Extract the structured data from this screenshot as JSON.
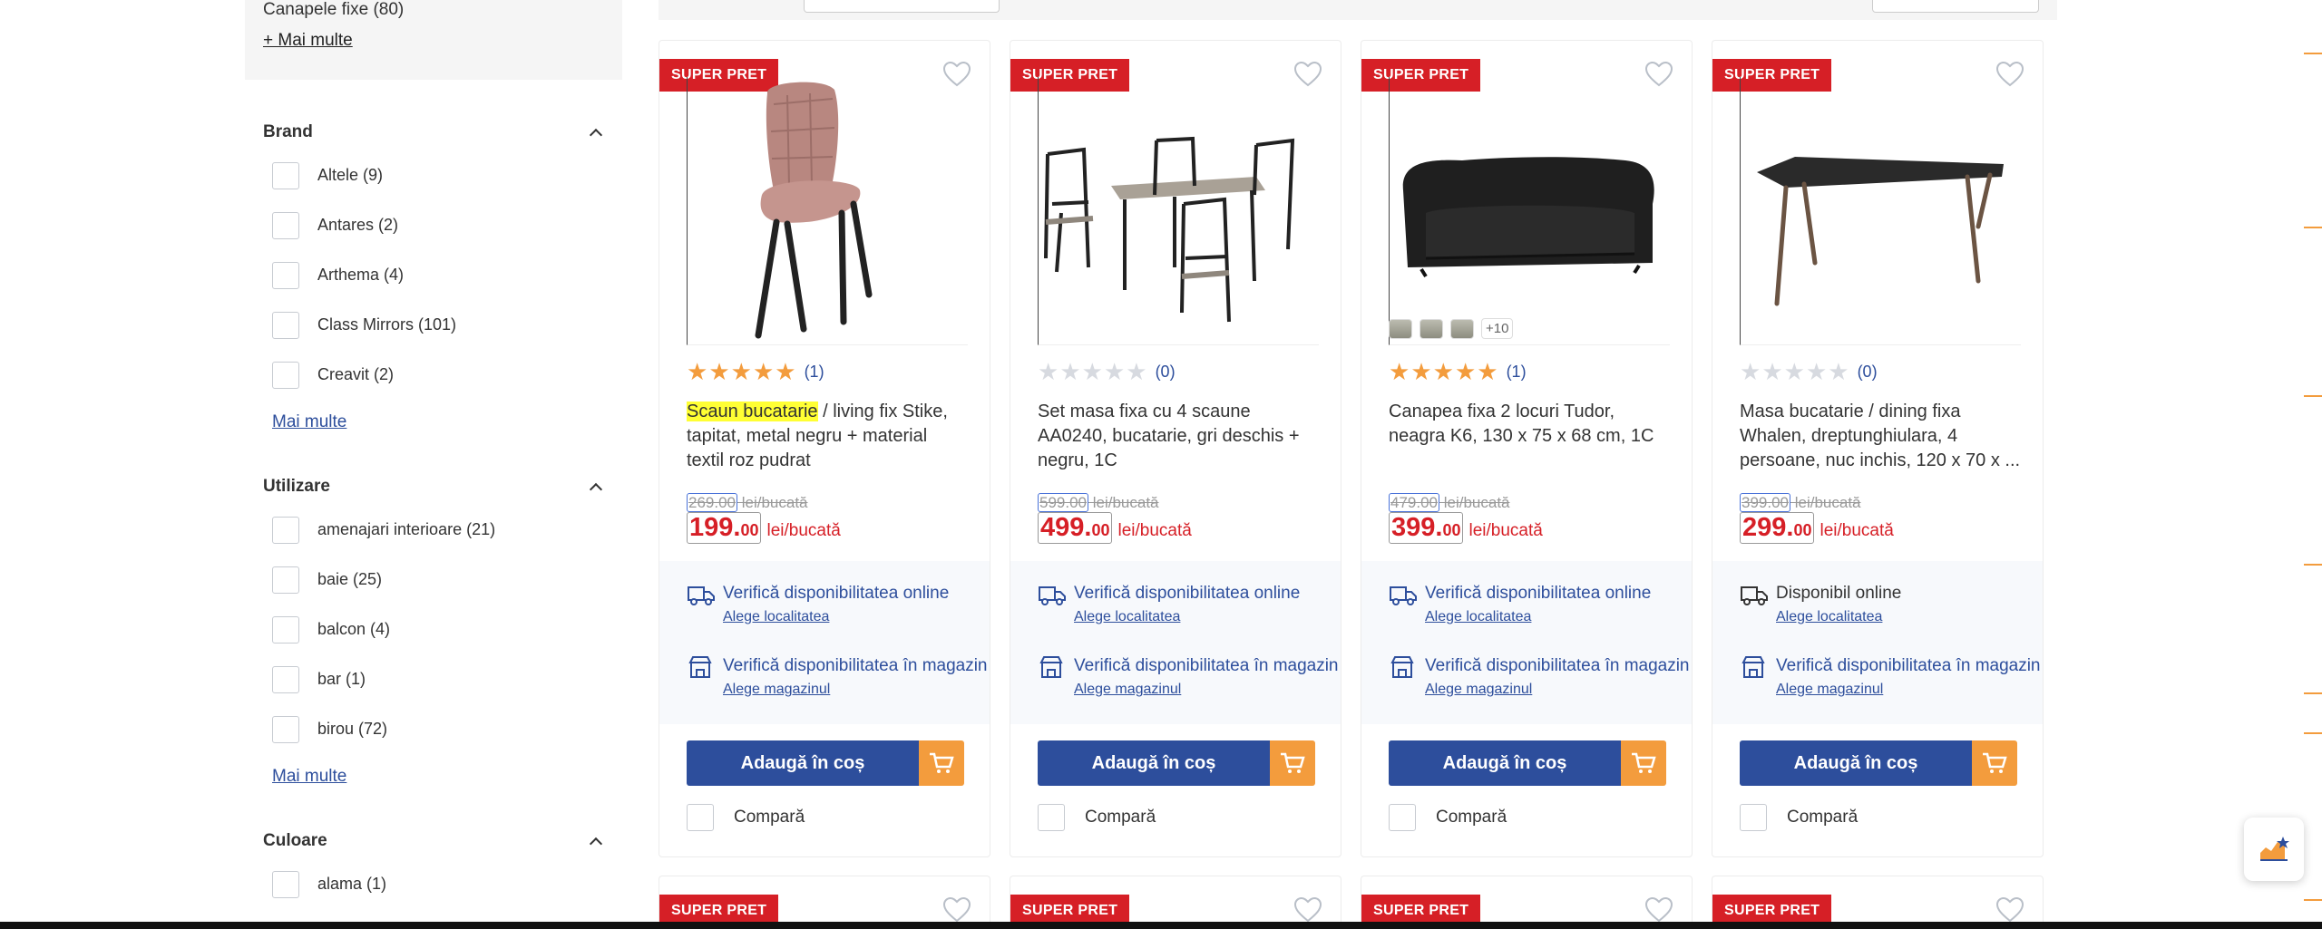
{
  "sidebar": {
    "prev_item": "Canapele fixe (80)",
    "prev_more": "+ Mai multe",
    "groups": [
      {
        "title": "Brand",
        "options": [
          "Altele (9)",
          "Antares (2)",
          "Arthema (4)",
          "Class Mirrors (101)",
          "Creavit (2)"
        ],
        "more": "Mai multe"
      },
      {
        "title": "Utilizare",
        "options": [
          "amenajari interioare (21)",
          "baie (25)",
          "balcon (4)",
          "bar (1)",
          "birou (72)"
        ],
        "more": "Mai multe"
      },
      {
        "title": "Culoare",
        "options": [
          "alama (1)"
        ]
      }
    ]
  },
  "products": [
    {
      "badge": "SUPER PRET",
      "rating_count": "(1)",
      "stars_on": 5,
      "title_highlight": "Scaun bucatarie",
      "title_rest": " / living fix Stike, tapitat, metal negru + material textil roz pudrat",
      "old_price": "269.00",
      "old_price_unit": " lei/bucată",
      "price_int": "199.",
      "price_dec": "00",
      "price_unit": "lei/bucată",
      "avail_online": "Verifică disponibilitatea online",
      "avail_online_link": "Alege localitatea",
      "avail_store": "Verifică disponibilitatea în magazin",
      "avail_store_link": "Alege magazinul",
      "cart": "Adaugă în coș",
      "compare": "Compară"
    },
    {
      "badge": "SUPER PRET",
      "rating_count": "(0)",
      "stars_on": 0,
      "title": "Set masa fixa cu 4 scaune AA0240, bucatarie, gri deschis + negru, 1C",
      "old_price": "599.00",
      "old_price_unit": " lei/bucată",
      "price_int": "499.",
      "price_dec": "00",
      "price_unit": "lei/bucată",
      "avail_online": "Verifică disponibilitatea online",
      "avail_online_link": "Alege localitatea",
      "avail_store": "Verifică disponibilitatea în magazin",
      "avail_store_link": "Alege magazinul",
      "cart": "Adaugă în coș",
      "compare": "Compară"
    },
    {
      "badge": "SUPER PRET",
      "rating_count": "(1)",
      "stars_on": 5,
      "title": "Canapea fixa 2 locuri Tudor, neagra K6, 130 x 75 x 68 cm, 1C",
      "swatch_more": "+10",
      "old_price": "479.00",
      "old_price_unit": " lei/bucată",
      "price_int": "399.",
      "price_dec": "00",
      "price_unit": "lei/bucată",
      "avail_online": "Verifică disponibilitatea online",
      "avail_online_link": "Alege localitatea",
      "avail_store": "Verifică disponibilitatea în magazin",
      "avail_store_link": "Alege magazinul",
      "cart": "Adaugă în coș",
      "compare": "Compară"
    },
    {
      "badge": "SUPER PRET",
      "rating_count": "(0)",
      "stars_on": 0,
      "title": "Masa bucatarie / dining fixa Whalen, dreptunghiulara, 4 persoane, nuc inchis, 120 x 70 x ...",
      "old_price": "399.00",
      "old_price_unit": " lei/bucată",
      "price_int": "299.",
      "price_dec": "00",
      "price_unit": "lei/bucată",
      "avail_online": "Disponibil online",
      "avail_online_link": "Alege localitatea",
      "avail_store": "Verifică disponibilitatea în magazin",
      "avail_store_link": "Alege magazinul",
      "cart": "Adaugă în coș",
      "compare": "Compară"
    }
  ],
  "second_row_badges": [
    "SUPER PRET",
    "SUPER PRET",
    "SUPER PRET",
    "SUPER PRET"
  ],
  "colors": {
    "accent_blue": "#2d4e9c",
    "accent_orange": "#f39c3d",
    "badge_red": "#d61f26"
  }
}
